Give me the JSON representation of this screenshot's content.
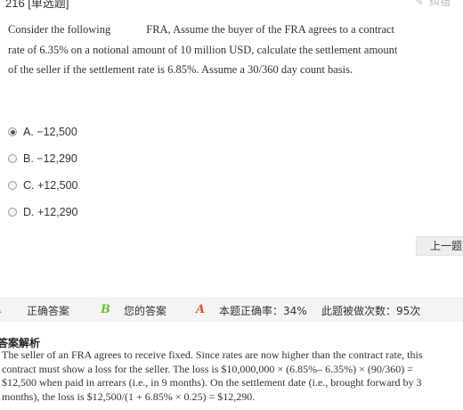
{
  "header": {
    "title": "216 [单选题]",
    "correct_error_label": "纠错"
  },
  "question": {
    "text_part1": "Consider the following",
    "text_part2": "FRA, Assume the buyer of the FRA agrees to a contract rate of 6.35% on a notional amount of 10 million USD, calculate the settlement amount of the seller if the settlement rate is 6.85%. Assume a 30/360 day count basis."
  },
  "options": [
    {
      "label": "A. −12,500",
      "selected": true
    },
    {
      "label": "B. −12,290",
      "selected": false
    },
    {
      "label": "C. +12,500",
      "selected": false
    },
    {
      "label": "D. +12,290",
      "selected": false
    }
  ],
  "navigation": {
    "prev_label": "上一题"
  },
  "status_bar": {
    "correct_answer_mark": "A",
    "correct_answer_label": "正确答案",
    "your_answer_mark": "B",
    "your_answer_label": "您的答案",
    "user_mark": "A",
    "accuracy_text": "本题正确率：34%",
    "attempts_text": "此题被做次数：95次",
    "colors": {
      "correct": "#e0532f",
      "yours": "#6fbf3b",
      "user": "#e0532f"
    }
  },
  "analysis": {
    "title": "答案解析",
    "text": "The seller of an FRA agrees to receive fixed. Since rates are now higher than the contract rate, this contract must show a loss for the seller. The loss is $10,000,000 × (6.85%– 6.35%) × (90/360) = $12,500 when paid in arrears (i.e., in 9 months). On the settlement date (i.e., brought forward by 3 months), the loss is $12,500/(1 + 6.85% × 0.25) = $12,290."
  }
}
